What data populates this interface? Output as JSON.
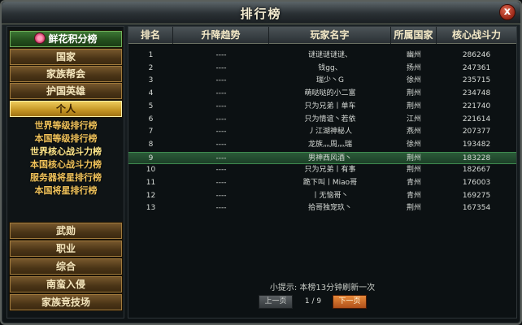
{
  "window": {
    "title": "排行榜",
    "close_label": "x"
  },
  "nav": {
    "top_tab": "鲜花积分榜",
    "tabs_upper": [
      "国家",
      "家族帮会",
      "护国英雄",
      "个人"
    ],
    "active_tab": "个人",
    "sub_items": [
      "世界等级排行榜",
      "本国等级排行榜",
      "世界核心战斗力榜",
      "本国核心战斗力榜",
      "服务器将星排行榜",
      "本国将星排行榜"
    ],
    "current_sub_item": "世界核心战斗力榜",
    "tabs_lower": [
      "武勋",
      "职业",
      "综合",
      "南蛮入侵",
      "家族竞技场"
    ]
  },
  "table": {
    "columns": [
      "排名",
      "升降趋势",
      "玩家名字",
      "所属国家",
      "核心战斗力"
    ],
    "rows": [
      {
        "rank": "1",
        "trend": "----",
        "name": "谜谜谜谜谜、",
        "country": "幽州",
        "power": "286246"
      },
      {
        "rank": "2",
        "trend": "----",
        "name": "钱gg、",
        "country": "扬州",
        "power": "247361"
      },
      {
        "rank": "3",
        "trend": "----",
        "name": "瑞少丶G",
        "country": "徐州",
        "power": "235715"
      },
      {
        "rank": "4",
        "trend": "----",
        "name": "萌哒哒的小二富",
        "country": "荆州",
        "power": "234748"
      },
      {
        "rank": "5",
        "trend": "----",
        "name": "只为兄弟丨单车",
        "country": "荆州",
        "power": "221740"
      },
      {
        "rank": "6",
        "trend": "----",
        "name": "只为情谊丶若依",
        "country": "江州",
        "power": "221614"
      },
      {
        "rank": "7",
        "trend": "----",
        "name": "丿江湖神秘人",
        "country": "燕州",
        "power": "207377"
      },
      {
        "rank": "8",
        "trend": "----",
        "name": "龙族灬周灬瑞",
        "country": "徐州",
        "power": "193482"
      },
      {
        "rank": "9",
        "trend": "----",
        "name": "男神西风酒丶",
        "country": "荆州",
        "power": "183228"
      },
      {
        "rank": "10",
        "trend": "----",
        "name": "只为兄弟丨有事",
        "country": "荆州",
        "power": "182667"
      },
      {
        "rank": "11",
        "trend": "----",
        "name": "跪下叫丨Miao哥",
        "country": "青州",
        "power": "176003"
      },
      {
        "rank": "12",
        "trend": "----",
        "name": "丨无恼哥丶",
        "country": "青州",
        "power": "169275"
      },
      {
        "rank": "13",
        "trend": "----",
        "name": "拾哥独宠玖丶",
        "country": "荆州",
        "power": "167354"
      }
    ],
    "highlight_rank": "9"
  },
  "footer": {
    "tip": "小提示: 本榜13分钟刷新一次",
    "prev_label": "上一页",
    "next_label": "下一页",
    "page_current": "1",
    "page_total": "9",
    "page_indicator": "1 / 9"
  },
  "colors": {
    "accent": "#f1d060",
    "highlight_row": "#2b5a38",
    "text_gold": "#f0c25a"
  }
}
